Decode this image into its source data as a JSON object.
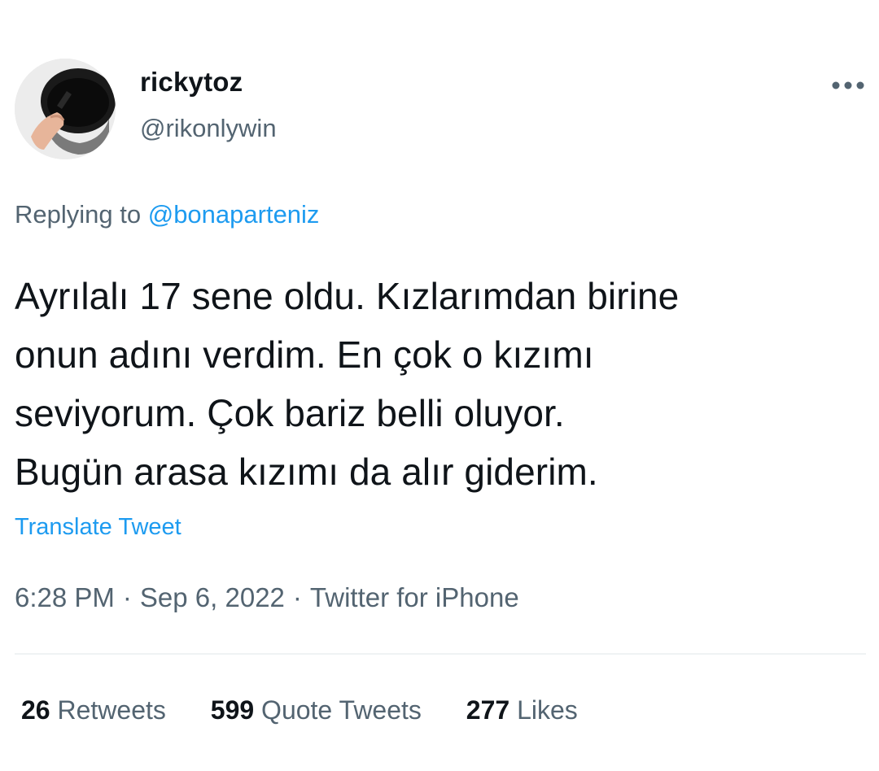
{
  "author": {
    "display_name": "rickytoz",
    "handle": "@rikonlywin",
    "avatar_icon": "avatar-photo"
  },
  "more_icon": "more-horizontal-icon",
  "reply": {
    "prefix": "Replying to",
    "mention": "@bonaparteniz"
  },
  "text_lines": [
    "Ayrılalı 17 sene oldu. Kızlarımdan birine",
    "onun adını verdim. En çok o kızımı",
    "seviyorum. Çok bariz belli oluyor.",
    "Bugün arasa kızımı da alır giderim."
  ],
  "translate_label": "Translate Tweet",
  "meta": {
    "time": "6:28 PM",
    "date": "Sep 6, 2022",
    "source": "Twitter for iPhone",
    "separator": "·"
  },
  "stats": {
    "retweets": {
      "count": "26",
      "label": "Retweets"
    },
    "quotes": {
      "count": "599",
      "label": "Quote Tweets"
    },
    "likes": {
      "count": "277",
      "label": "Likes"
    }
  },
  "colors": {
    "text": "#0f1419",
    "secondary": "#536471",
    "link": "#1d9bf0",
    "divider": "#eff3f4"
  }
}
